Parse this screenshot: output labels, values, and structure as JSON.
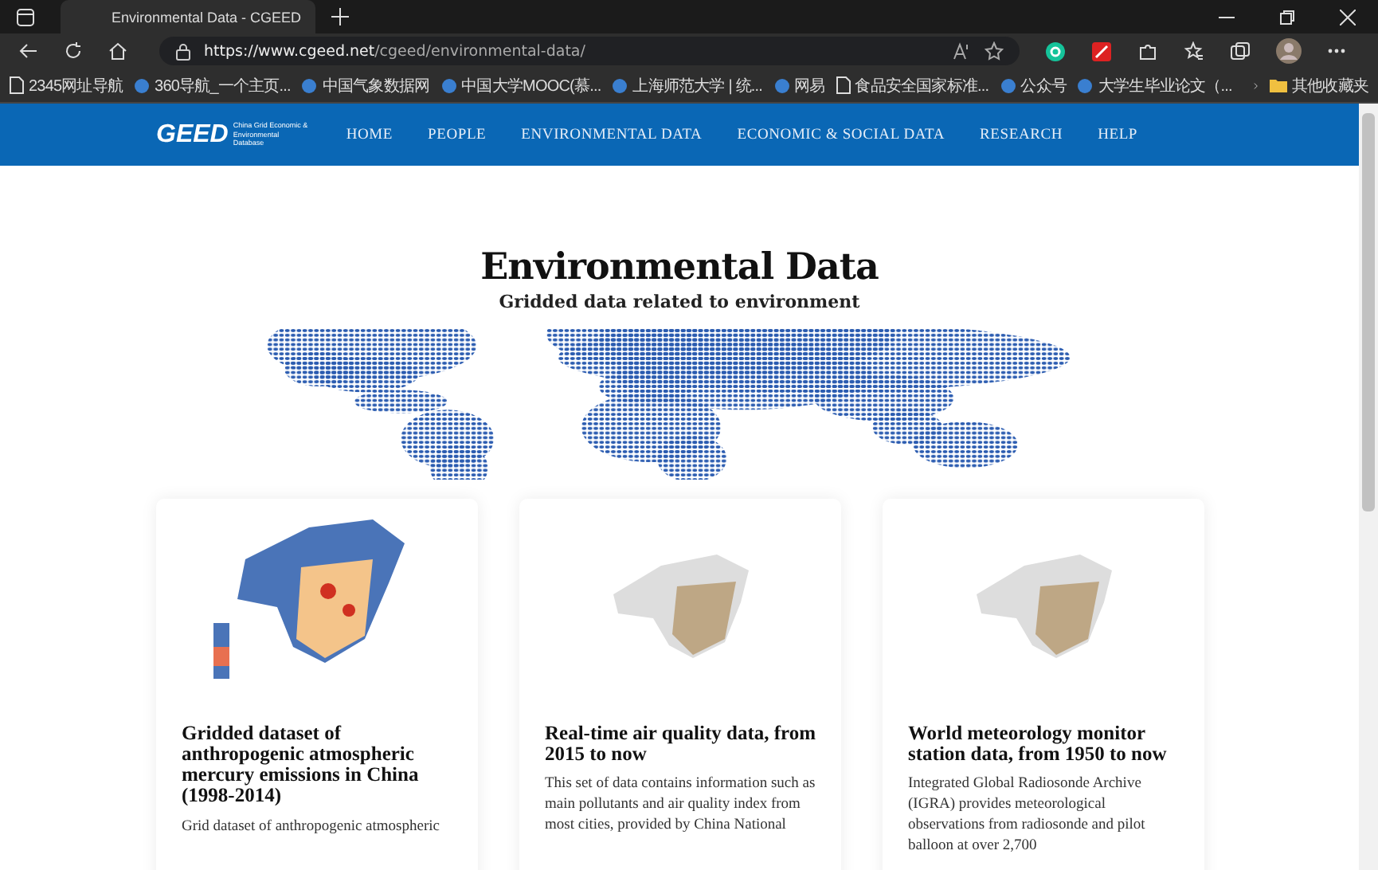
{
  "browser": {
    "tab_title": "Environmental Data - CGEED",
    "url_host": "https://www.cgeed.net",
    "url_path": "/cgeed/environmental-data/",
    "bookmarks": [
      {
        "label": "2345网址导航",
        "kind": "page"
      },
      {
        "label": "360导航_一个主页...",
        "kind": "site"
      },
      {
        "label": "中国气象数据网",
        "kind": "site"
      },
      {
        "label": "中国大学MOOC(慕...",
        "kind": "site"
      },
      {
        "label": "上海师范大学 | 统...",
        "kind": "site"
      },
      {
        "label": "网易",
        "kind": "site"
      },
      {
        "label": "食品安全国家标准...",
        "kind": "page"
      },
      {
        "label": "公众号",
        "kind": "site"
      },
      {
        "label": "大学生毕业论文（...",
        "kind": "site"
      }
    ],
    "other_bookmarks": "其他收藏夹"
  },
  "site": {
    "logo": "GEED",
    "logo_subtitle": "China Grid Economic & Environmental Database",
    "nav": [
      {
        "label": "HOME"
      },
      {
        "label": "PEOPLE"
      },
      {
        "label": "ENVIRONMENTAL DATA"
      },
      {
        "label": "ECONOMIC & SOCIAL DATA"
      },
      {
        "label": "RESEARCH"
      },
      {
        "label": "HELP"
      }
    ]
  },
  "hero": {
    "title": "Environmental Data",
    "subtitle": "Gridded data related to environment"
  },
  "cards": [
    {
      "kind": "emission",
      "title": "Gridded dataset of anthropogenic atmospheric mercury emissions in China (1998-2014)",
      "text": "Grid dataset of anthropogenic atmospheric"
    },
    {
      "kind": "stations",
      "title": "Real-time air quality data, from 2015 to now",
      "text": "This set of data contains information such as main pollutants and air quality index from most cities, provided by China National"
    },
    {
      "kind": "stations",
      "title": "World meteorology monitor station data, from 1950 to now",
      "text": "Integrated Global Radiosonde Archive (IGRA) provides meteorological observations from radiosonde and pilot balloon at over 2,700"
    }
  ]
}
